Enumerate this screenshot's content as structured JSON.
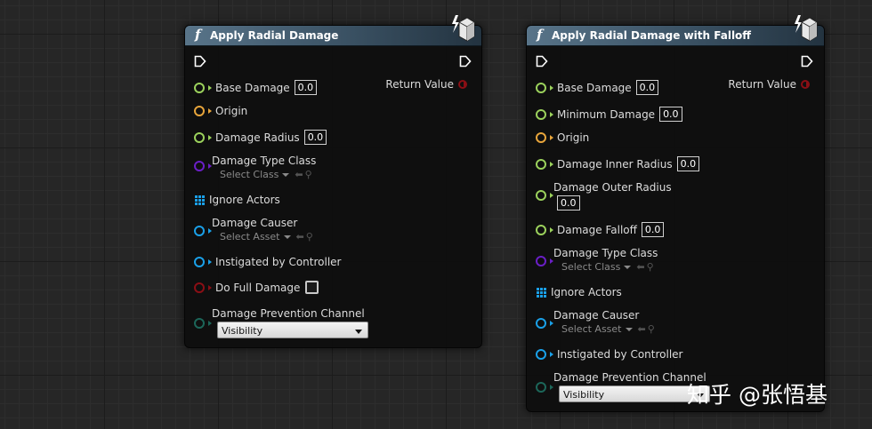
{
  "node1": {
    "title": "Apply Radial Damage",
    "return_label": "Return Value",
    "rows": {
      "base_damage": {
        "label": "Base Damage",
        "value": "0.0"
      },
      "origin": {
        "label": "Origin"
      },
      "damage_radius": {
        "label": "Damage Radius",
        "value": "0.0"
      },
      "damage_type_class": {
        "label": "Damage Type Class",
        "select": "Select Class"
      },
      "ignore_actors": {
        "label": "Ignore Actors"
      },
      "damage_causer": {
        "label": "Damage Causer",
        "select": "Select Asset"
      },
      "instigated_by": {
        "label": "Instigated by Controller"
      },
      "do_full_damage": {
        "label": "Do Full Damage"
      },
      "prevention_channel": {
        "label": "Damage Prevention Channel",
        "value": "Visibility"
      }
    }
  },
  "node2": {
    "title": "Apply Radial Damage with Falloff",
    "return_label": "Return Value",
    "rows": {
      "base_damage": {
        "label": "Base Damage",
        "value": "0.0"
      },
      "minimum_damage": {
        "label": "Minimum Damage",
        "value": "0.0"
      },
      "origin": {
        "label": "Origin"
      },
      "inner_radius": {
        "label": "Damage Inner Radius",
        "value": "0.0"
      },
      "outer_radius": {
        "label": "Damage Outer Radius",
        "value": "0.0"
      },
      "falloff": {
        "label": "Damage Falloff",
        "value": "0.0"
      },
      "damage_type_class": {
        "label": "Damage Type Class",
        "select": "Select Class"
      },
      "ignore_actors": {
        "label": "Ignore Actors"
      },
      "damage_causer": {
        "label": "Damage Causer",
        "select": "Select Asset"
      },
      "instigated_by": {
        "label": "Instigated by Controller"
      },
      "prevention_channel": {
        "label": "Damage Prevention Channel",
        "value": "Visibility"
      }
    }
  },
  "watermark": "知乎 @张悟基",
  "colors": {
    "float_pin": "#9bd15c",
    "vector_pin": "#e8a53b",
    "class_pin": "#6a1fc6",
    "object_pin": "#1aa0e8",
    "bool_pin": "#8a0f15",
    "enum_pin": "#1c6659",
    "header": "#3a5163"
  }
}
